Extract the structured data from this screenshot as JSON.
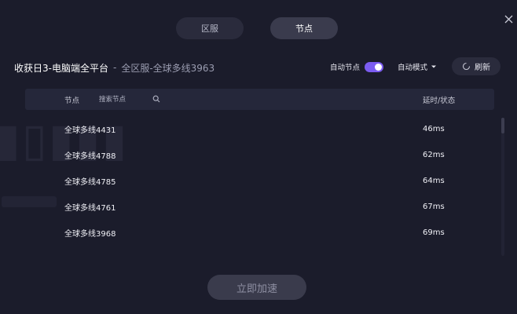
{
  "tabs": [
    {
      "label": "区服",
      "active": false
    },
    {
      "label": "节点",
      "active": true
    }
  ],
  "header": {
    "game_title": "收获日3-电脑端全平台",
    "separator": "-",
    "server_path": "全区服-全球多线3963"
  },
  "controls": {
    "auto_node_label": "自动节点",
    "auto_node_enabled": true,
    "auto_mode_label": "自动模式",
    "refresh_label": "刷新"
  },
  "table": {
    "col_node": "节点",
    "search_placeholder": "搜索节点",
    "col_latency": "延时/状态",
    "rows": [
      {
        "name": "全球多线4431",
        "latency": "46ms"
      },
      {
        "name": "全球多线4788",
        "latency": "62ms"
      },
      {
        "name": "全球多线4785",
        "latency": "64ms"
      },
      {
        "name": "全球多线4761",
        "latency": "67ms"
      },
      {
        "name": "全球多线3968",
        "latency": "69ms"
      }
    ]
  },
  "footer": {
    "accelerate_label": "立即加速"
  },
  "colors": {
    "background": "#1b1c2b",
    "accent": "#7b5cf0",
    "panel": "#25273a"
  },
  "icons": {
    "close": "close-icon",
    "search": "search-icon",
    "dropdown": "caret-down-icon",
    "refresh": "refresh-icon"
  }
}
